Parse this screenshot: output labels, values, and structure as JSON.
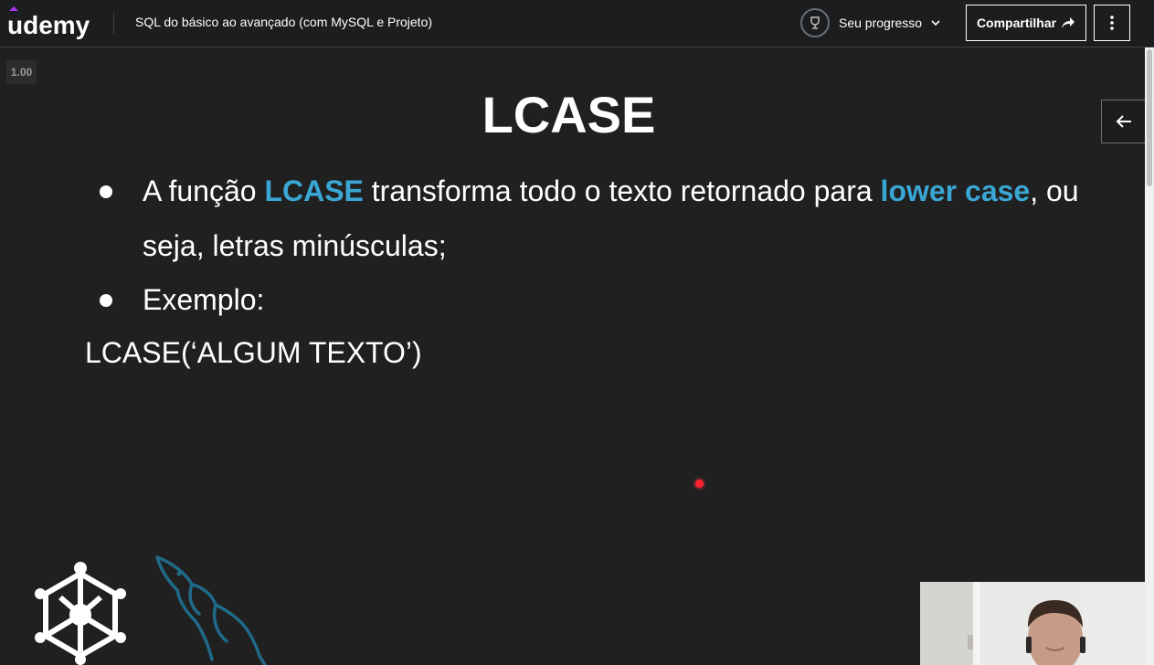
{
  "header": {
    "brand": "udemy",
    "course_title": "SQL do básico ao avançado (com MySQL e Projeto)",
    "progress_label": "Seu progresso",
    "share_label": "Compartilhar"
  },
  "player": {
    "speed": "1.00"
  },
  "slide": {
    "title": "LCASE",
    "bullet1": {
      "prefix": "A função ",
      "hl1": "LCASE",
      "middle": " transforma todo o texto retornado para ",
      "hl2": "lower case",
      "suffix": ", ou",
      "line2": "seja, letras minúsculas;"
    },
    "bullet2": "Exemplo:",
    "code": "LCASE(‘ALGUM TEXTO’)"
  },
  "colors": {
    "highlight": "#3aa6d4",
    "brand_purple": "#a435f0",
    "laser": "#ff2030"
  }
}
